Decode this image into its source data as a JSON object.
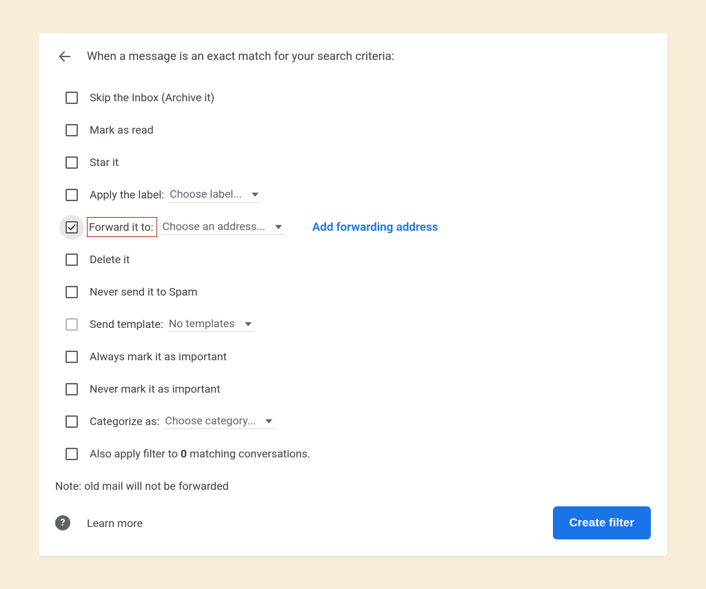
{
  "header": {
    "title": "When a message is an exact match for your search criteria:"
  },
  "options": {
    "skip_inbox": "Skip the Inbox (Archive it)",
    "mark_read": "Mark as read",
    "star": "Star it",
    "apply_label": "Apply the label:",
    "apply_label_dropdown": "Choose label...",
    "forward": "Forward it to:",
    "forward_dropdown": "Choose an address...",
    "forward_link": "Add forwarding address",
    "delete": "Delete it",
    "never_spam": "Never send it to Spam",
    "send_template": "Send template:",
    "send_template_dropdown": "No templates",
    "always_important": "Always mark it as important",
    "never_important": "Never mark it as important",
    "categorize": "Categorize as:",
    "categorize_dropdown": "Choose category...",
    "also_apply_pre": "Also apply filter to ",
    "also_apply_count": "0",
    "also_apply_post": " matching conversations."
  },
  "note": "Note: old mail will not be forwarded",
  "footer": {
    "learn_more": "Learn more",
    "create_filter": "Create filter"
  }
}
